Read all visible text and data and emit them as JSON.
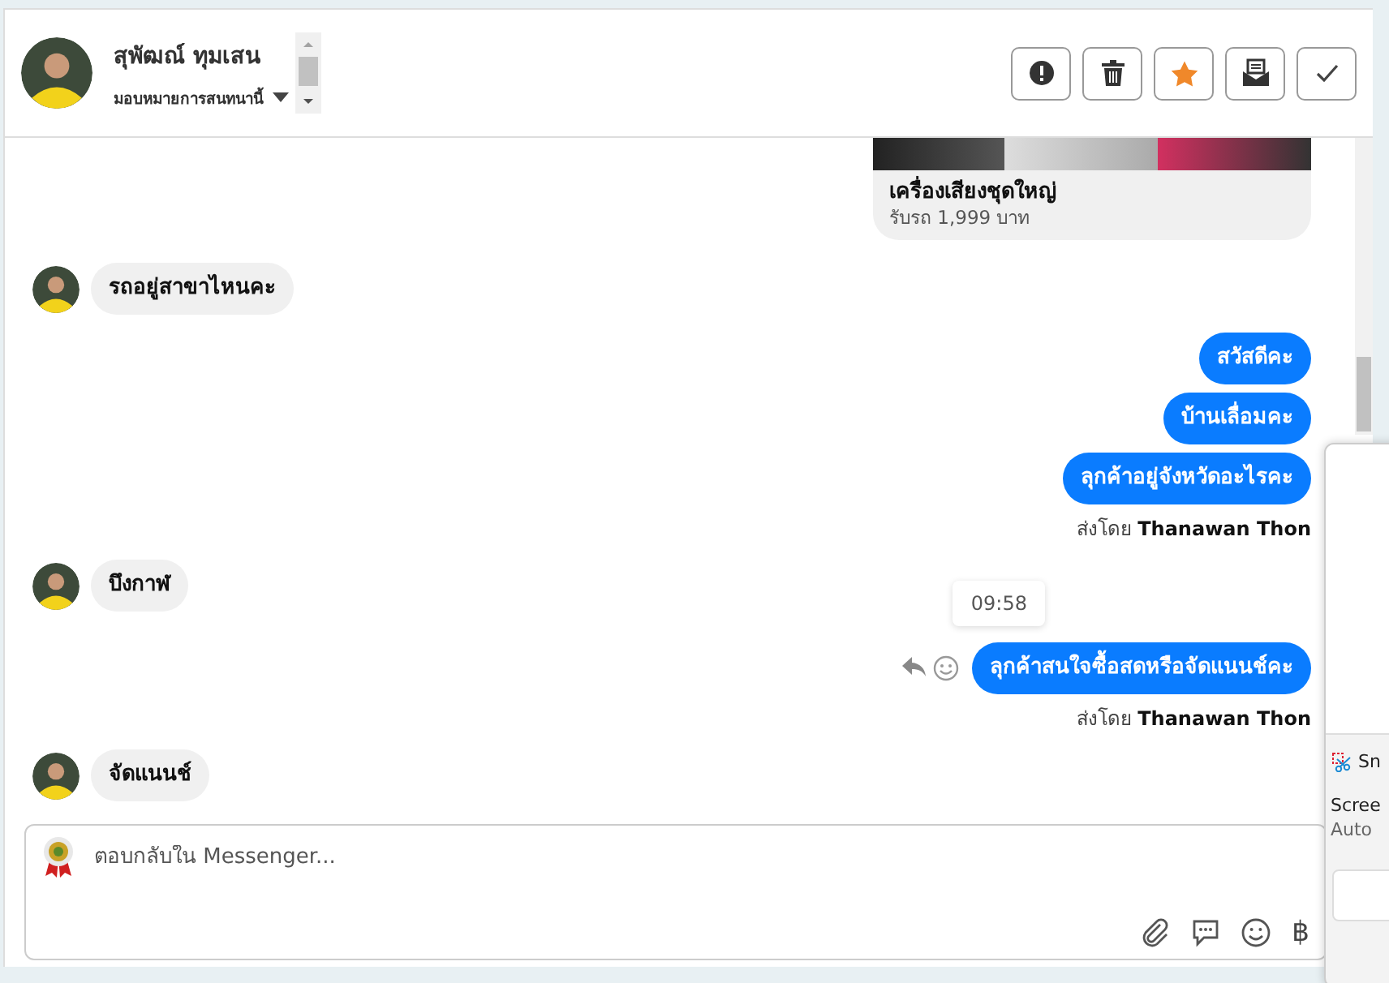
{
  "header": {
    "name": "สุพัฒณ์ ทุมเสน",
    "assign_label": "มอบหมายการสนทนานี้",
    "actions": [
      {
        "kind": "alert"
      },
      {
        "kind": "trash"
      },
      {
        "kind": "star"
      },
      {
        "kind": "unread"
      },
      {
        "kind": "done"
      }
    ]
  },
  "messages": [
    {
      "kind": "card",
      "title": "เครื่องเสียงชุดใหญ่",
      "subtitle": "รับรถ 1,999 บาท"
    },
    {
      "kind": "incoming",
      "text": "รถอยู่สาขาไหนคะ"
    },
    {
      "kind": "outgoing",
      "text": "สวัสดีคะ"
    },
    {
      "kind": "outgoing",
      "text": "บ้านเลื่อมคะ"
    },
    {
      "kind": "outgoing",
      "text": "ลุกค้าอยู่จังหวัดอะไรคะ"
    },
    {
      "kind": "note",
      "prefix": "ส่งโดย",
      "sender": "Thanawan Thon"
    },
    {
      "kind": "incoming",
      "text": "บึงกาฬ"
    },
    {
      "kind": "outgoing",
      "text": "ลุกค้าสนใจซื้อสดหรือจัดแนนช์คะ",
      "time": "09:58",
      "hovered": true
    },
    {
      "kind": "note",
      "prefix": "ส่งโดย",
      "sender": "Thanawan Thon"
    },
    {
      "kind": "incoming",
      "text": "จัดแนนช์"
    }
  ],
  "composer": {
    "placeholder": "ตอบกลับใน Messenger...",
    "currency": "฿"
  },
  "notification": {
    "app": "Sn",
    "title": "Scree",
    "body": "Auto"
  }
}
